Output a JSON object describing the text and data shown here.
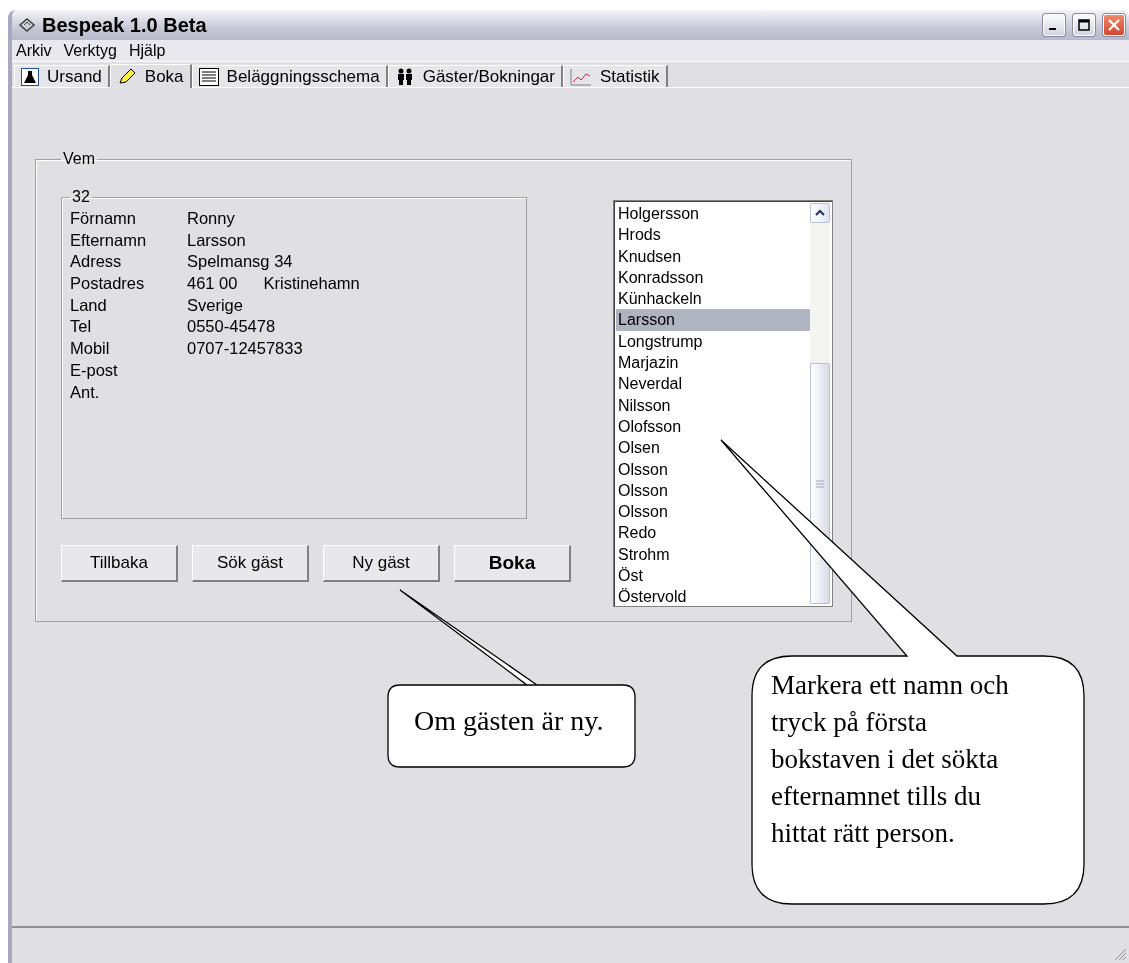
{
  "window": {
    "title": "Bespeak 1.0 Beta"
  },
  "menu": [
    "Arkiv",
    "Verktyg",
    "Hjälp"
  ],
  "tabs": [
    {
      "label": "Ursand",
      "selected": false
    },
    {
      "label": "Boka",
      "selected": true
    },
    {
      "label": "Beläggningsschema",
      "selected": false
    },
    {
      "label": "Gäster/Bokningar",
      "selected": false
    },
    {
      "label": "Statistik",
      "selected": false
    }
  ],
  "guest_group": {
    "title": "Vem",
    "record": {
      "title": "32",
      "fields": [
        {
          "label": "Förnamn",
          "value": "Ronny"
        },
        {
          "label": "Efternamn",
          "value": "Larsson"
        },
        {
          "label": "Adress",
          "value": "Spelmansg 34"
        },
        {
          "label": "Postadres",
          "value": "461 00",
          "value_2": "Kristinehamn"
        },
        {
          "label": "Land",
          "value": "Sverige"
        },
        {
          "label": "Tel",
          "value": "0550-45478"
        },
        {
          "label": "Mobil",
          "value": "0707-12457833"
        },
        {
          "label": "E-post"
        },
        {
          "label": "Ant."
        }
      ]
    },
    "buttons": [
      {
        "label": "Tillbaka",
        "default": false
      },
      {
        "label": "Sök gäst",
        "default": false
      },
      {
        "label": "Ny gäst",
        "default": false
      },
      {
        "label": "Boka",
        "default": true
      }
    ],
    "surname_list": [
      {
        "label": "Holgersson",
        "selected": false
      },
      {
        "label": "Hrods",
        "selected": false
      },
      {
        "label": "Knudsen",
        "selected": false
      },
      {
        "label": "Konradsson",
        "selected": false
      },
      {
        "label": "Künhackeln",
        "selected": false
      },
      {
        "label": "Larsson",
        "selected": true
      },
      {
        "label": "Longstrump",
        "selected": false
      },
      {
        "label": "Marjazin",
        "selected": false
      },
      {
        "label": "Neverdal",
        "selected": false
      },
      {
        "label": "Nilsson",
        "selected": false
      },
      {
        "label": "Olofsson",
        "selected": false
      },
      {
        "label": "Olsen",
        "selected": false
      },
      {
        "label": "Olsson",
        "selected": false
      },
      {
        "label": "Olsson",
        "selected": false
      },
      {
        "label": "Olsson",
        "selected": false
      },
      {
        "label": "Redo",
        "selected": false
      },
      {
        "label": "Strohm",
        "selected": false
      },
      {
        "label": "Öst",
        "selected": false
      },
      {
        "label": "Östervold",
        "selected": false
      }
    ]
  },
  "callouts": [
    {
      "text": "Om gästen är ny."
    },
    {
      "text": "Markera ett namn och tryck på första bokstaven i det sökta efternamnet tills du hittat rätt person."
    }
  ]
}
